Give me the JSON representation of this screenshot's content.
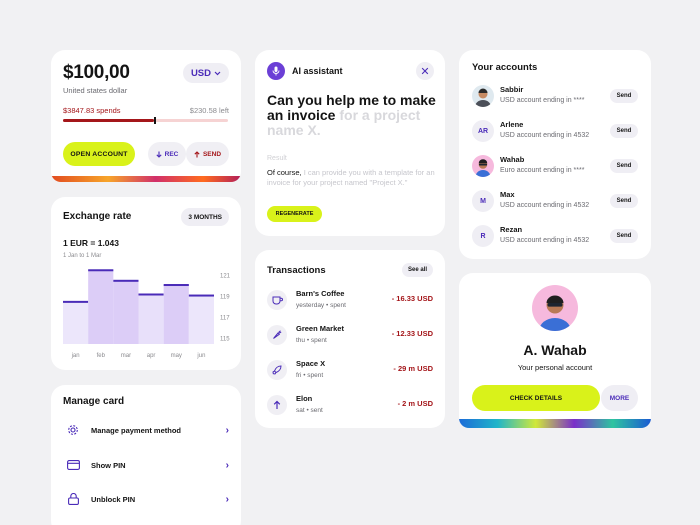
{
  "balance": {
    "amount": "$100,00",
    "currency_name": "United states dollar",
    "currency_code": "USD",
    "spends": "$3847.83 spends",
    "left": "$230.58 left",
    "spent_fraction": 0.55,
    "open_account": "OPEN ACCOUNT",
    "rec": "REC",
    "send": "SEND"
  },
  "exchange": {
    "title": "Exchange rate",
    "period": "3 MONTHS",
    "rate": "1 EUR = 1.043",
    "range": "1 Jan to 1 Mar"
  },
  "chart_data": {
    "type": "bar",
    "categories": [
      "jan",
      "feb",
      "mar",
      "apr",
      "may",
      "jun"
    ],
    "values": [
      118.5,
      121.5,
      120.5,
      119.2,
      120.1,
      119.1
    ],
    "y_ticks": [
      "121",
      "119",
      "117",
      "115"
    ],
    "ylim": [
      114.5,
      122
    ]
  },
  "manage": {
    "title": "Manage card",
    "items": [
      {
        "label": "Manage payment method"
      },
      {
        "label": "Show PIN"
      },
      {
        "label": "Unblock PIN"
      }
    ]
  },
  "ai": {
    "title": "AI assistant",
    "question_main": "Can you help me to make an invoice",
    "question_fade": "for a project name X.",
    "result_label": "Result",
    "answer_main": "Of course,",
    "answer_fade": "I can provide you with a template for an invoice for your project named \"Project X.\"",
    "regenerate": "REGENERATE"
  },
  "transactions": {
    "title": "Transactions",
    "see_all": "See all",
    "items": [
      {
        "name": "Barn's Coffee",
        "sub": "yesterday • spent",
        "amount": "- 16.33 USD",
        "icon": "coffee-icon"
      },
      {
        "name": "Green Market",
        "sub": "thu • spent",
        "amount": "- 12.33 USD",
        "icon": "carrot-icon"
      },
      {
        "name": "Space X",
        "sub": "fri • spent",
        "amount": "- 29 m USD",
        "icon": "rocket-icon"
      },
      {
        "name": "Elon",
        "sub": "sat • sent",
        "amount": "- 2 m USD",
        "icon": "arrow-up-icon"
      }
    ]
  },
  "accounts": {
    "title": "Your accounts",
    "send_label": "Send",
    "items": [
      {
        "name": "Sabbir",
        "sub": "USD account ending in ****",
        "initials": ""
      },
      {
        "name": "Arlene",
        "sub": "USD account ending in 4532",
        "initials": "AR"
      },
      {
        "name": "Wahab",
        "sub": "Euro account ending in ****",
        "initials": ""
      },
      {
        "name": "Max",
        "sub": "USD account ending in 4532",
        "initials": "M"
      },
      {
        "name": "Rezan",
        "sub": "USD account ending in 4532",
        "initials": "R"
      }
    ]
  },
  "profile": {
    "name": "A. Wahab",
    "subtitle": "Your personal account",
    "check_details": "CHECK DETAILS",
    "more": "MORE"
  },
  "colors": {
    "accent_lime": "#d9f21a",
    "accent_purple": "#4a2bb8",
    "negative_red": "#a4161a"
  }
}
